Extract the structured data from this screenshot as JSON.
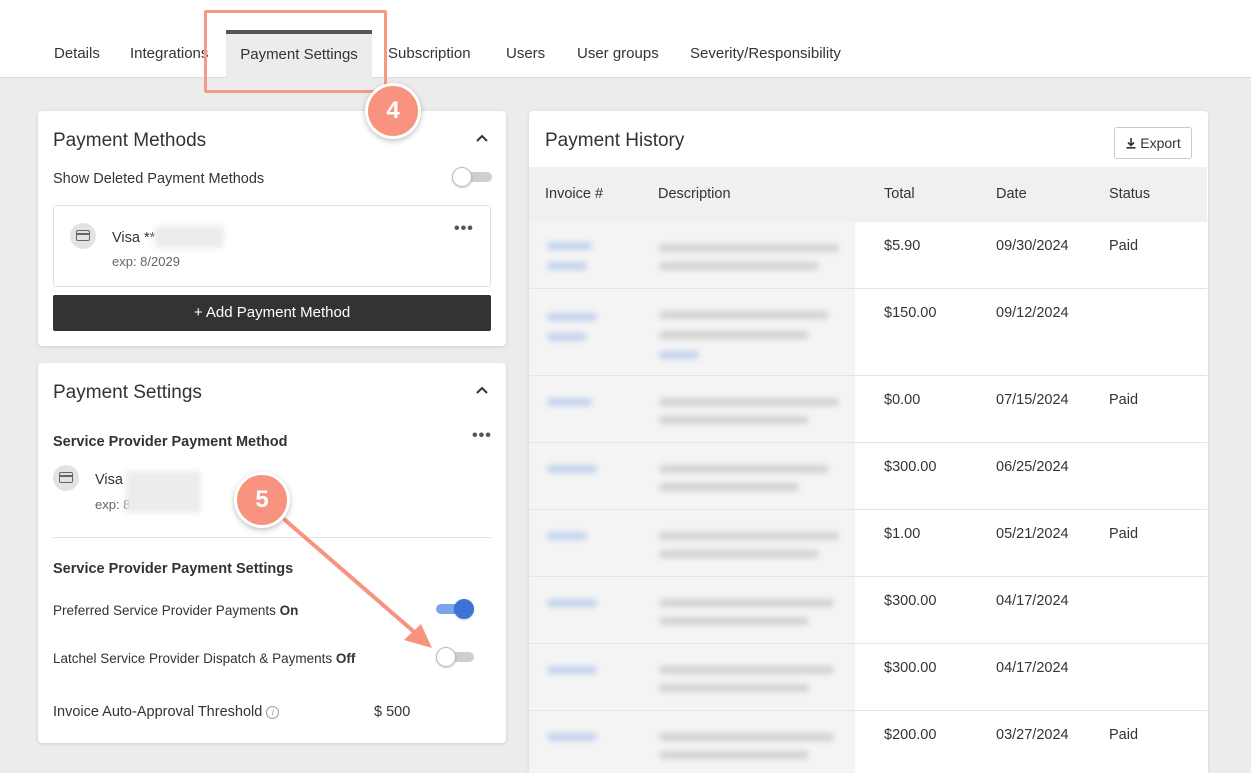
{
  "tabs": [
    {
      "label": "Details"
    },
    {
      "label": "Integrations"
    },
    {
      "label": "Payment Settings"
    },
    {
      "label": "Subscription"
    },
    {
      "label": "Users"
    },
    {
      "label": "User groups"
    },
    {
      "label": "Severity/Responsibility"
    }
  ],
  "active_tab": "Payment Settings",
  "annotations": {
    "step4": "4",
    "step5": "5",
    "color": "#f7937e"
  },
  "payment_methods": {
    "title": "Payment Methods",
    "show_deleted_label": "Show Deleted Payment Methods",
    "show_deleted_on": false,
    "card_name": "Visa **",
    "card_exp": "exp: 8/2029",
    "add_button": "+ Add Payment Method"
  },
  "payment_settings": {
    "title": "Payment Settings",
    "sp_method_heading": "Service Provider Payment Method",
    "card_name": "Visa",
    "card_exp": "exp: 8",
    "sp_settings_heading": "Service Provider Payment Settings",
    "preferred_label": "Preferred Service Provider Payments",
    "preferred_state": "On",
    "preferred_on": true,
    "latchel_label": "Latchel Service Provider Dispatch & Payments",
    "latchel_state": "Off",
    "latchel_on": false,
    "threshold_label": "Invoice Auto-Approval Threshold",
    "threshold_value": "$ 500"
  },
  "payment_history": {
    "title": "Payment History",
    "export_label": "Export",
    "columns": [
      "Invoice #",
      "Description",
      "Total",
      "Date",
      "Status"
    ],
    "rows": [
      {
        "total": "$5.90",
        "date": "09/30/2024",
        "status": "Paid"
      },
      {
        "total": "$150.00",
        "date": "09/12/2024",
        "status": ""
      },
      {
        "total": "$0.00",
        "date": "07/15/2024",
        "status": "Paid"
      },
      {
        "total": "$300.00",
        "date": "06/25/2024",
        "status": ""
      },
      {
        "total": "$1.00",
        "date": "05/21/2024",
        "status": "Paid"
      },
      {
        "total": "$300.00",
        "date": "04/17/2024",
        "status": ""
      },
      {
        "total": "$300.00",
        "date": "04/17/2024",
        "status": ""
      },
      {
        "total": "$200.00",
        "date": "03/27/2024",
        "status": "Paid"
      }
    ]
  },
  "colors": {
    "accent_toggle": "#3b73d9",
    "dark_button": "#333333",
    "annotation": "#f7937e"
  }
}
